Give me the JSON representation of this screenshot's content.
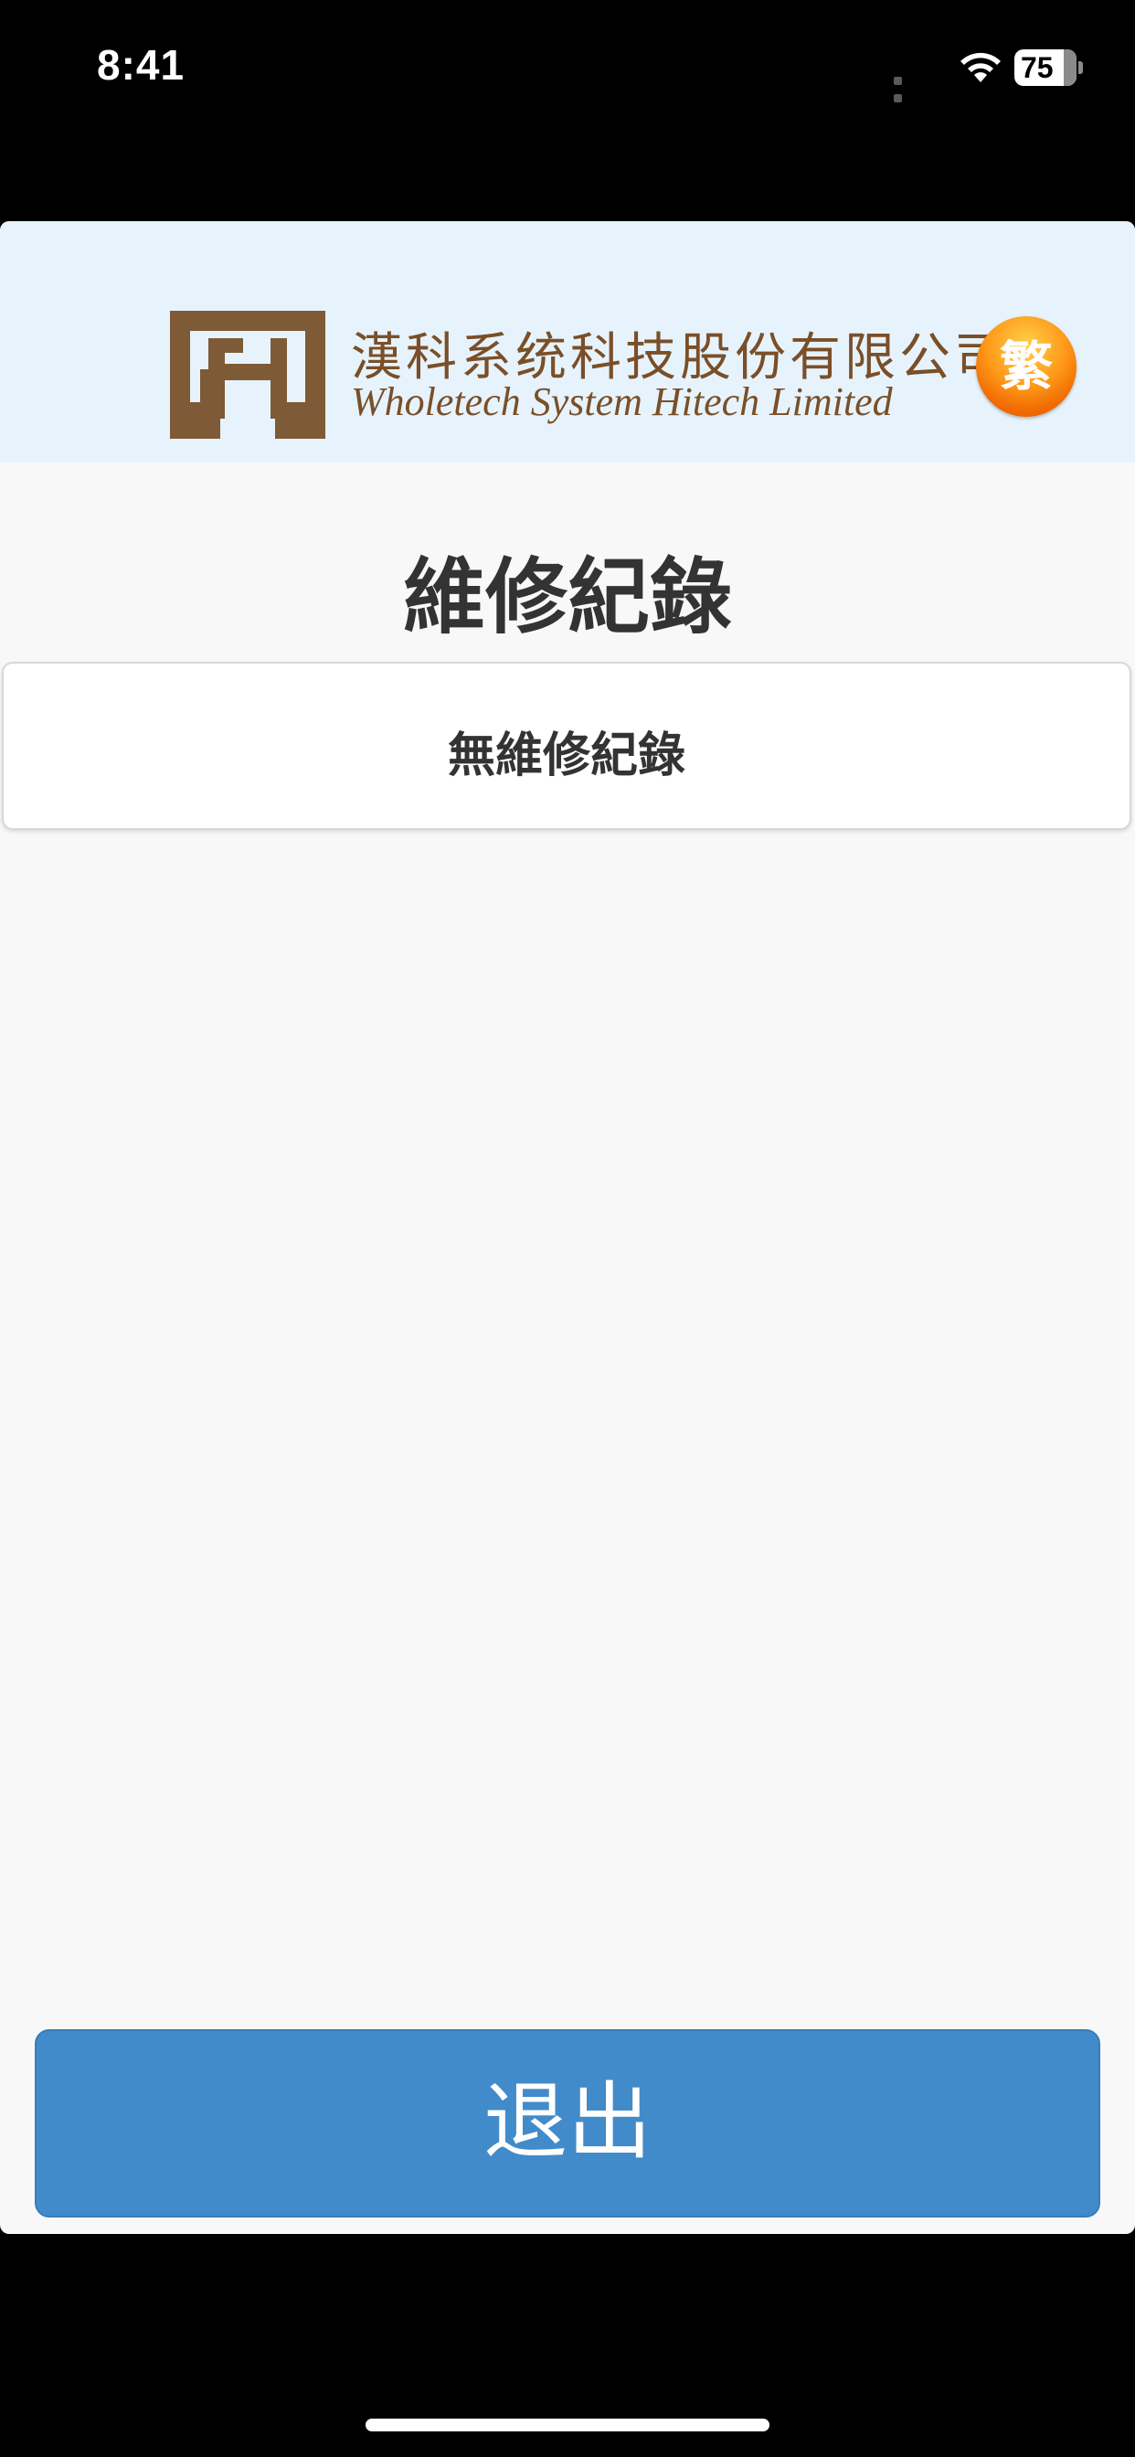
{
  "status_bar": {
    "time": "8:41",
    "battery_level": "75",
    "icons": [
      "signal-icon",
      "wifi-icon",
      "battery-icon"
    ]
  },
  "header": {
    "company_name_cn": "漢科系统科技股份有限公司",
    "company_name_en": "Wholetech System Hitech Limited",
    "language_toggle": "繁"
  },
  "main": {
    "title": "維修紀錄",
    "empty_message": "無維修紀錄"
  },
  "footer": {
    "exit_label": "退出"
  },
  "colors": {
    "header_bg": "#e6f3fc",
    "brand_brown": "#7a4f28",
    "button_blue": "#428bca",
    "page_bg": "#f8f8f8",
    "lang_button_orange": "#ff9a1a"
  }
}
